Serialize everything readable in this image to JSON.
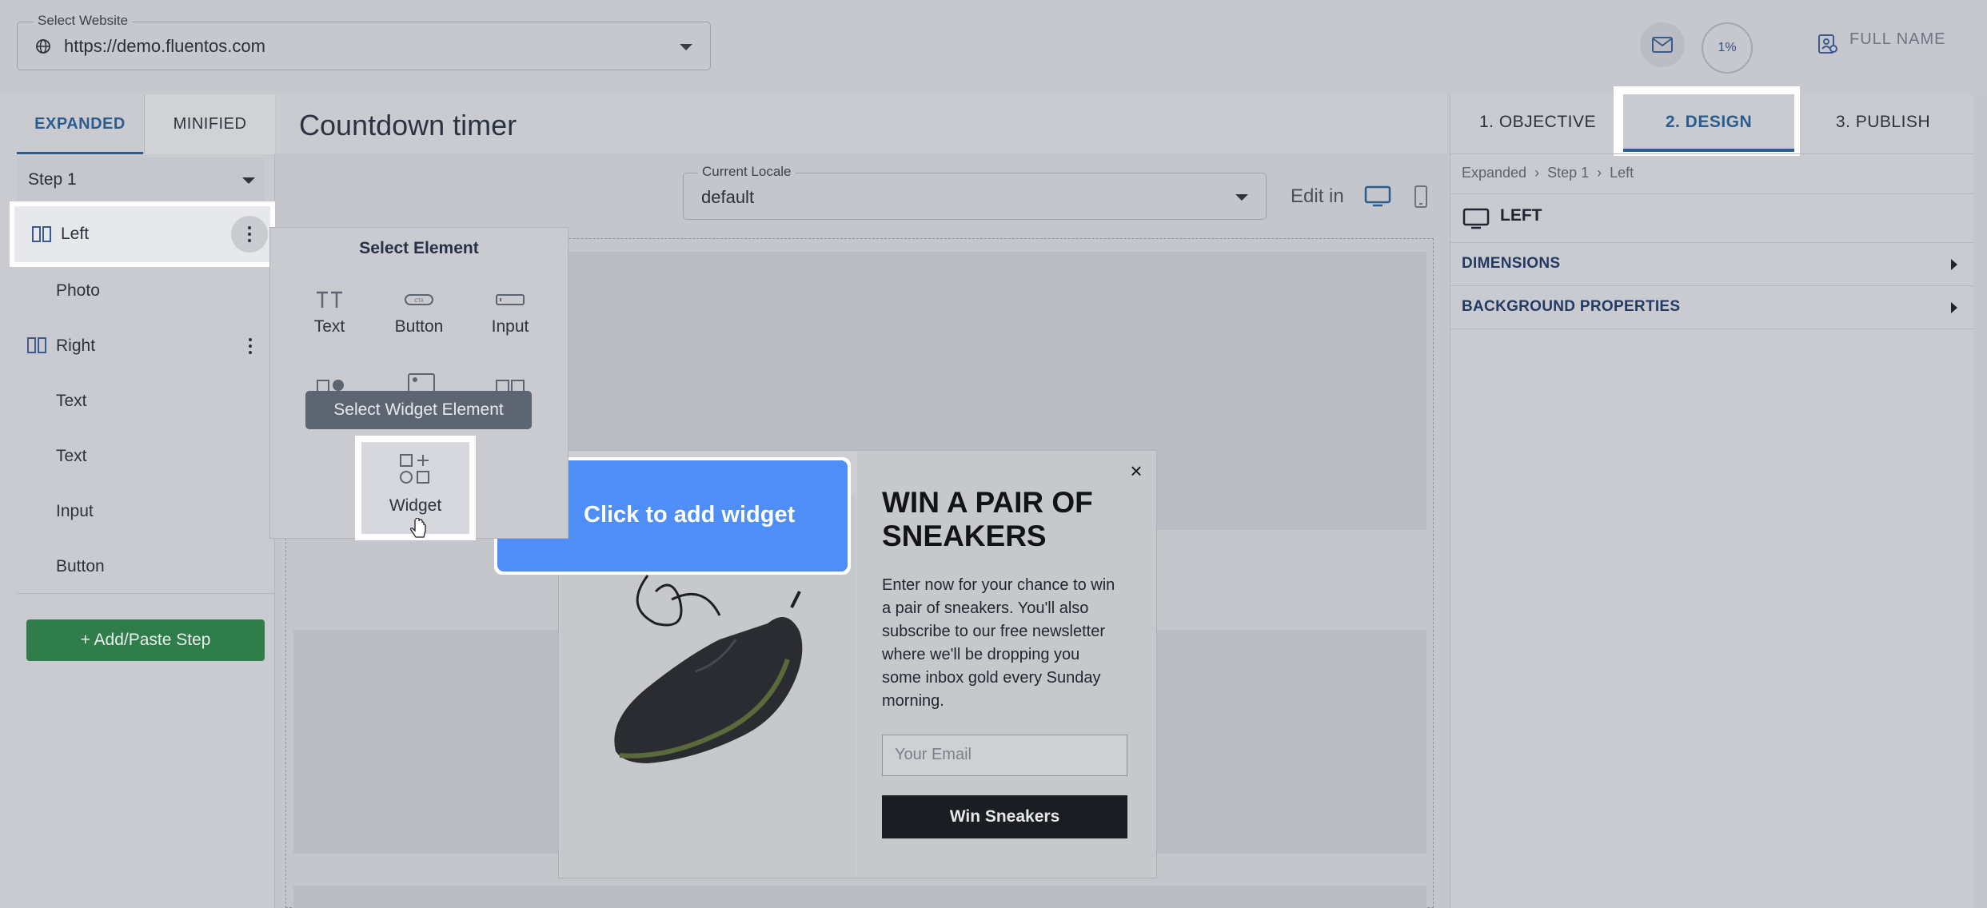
{
  "header": {
    "website_label": "Select Website",
    "website_value": "https://demo.fluentos.com",
    "progress": "1%",
    "user_name": "FULL NAME"
  },
  "left_panel": {
    "tabs": [
      {
        "label": "EXPANDED"
      },
      {
        "label": "MINIFIED"
      }
    ],
    "step_select": "Step 1",
    "tree": [
      {
        "label": "Left"
      },
      {
        "label": "Photo"
      },
      {
        "label": "Right"
      },
      {
        "label": "Text"
      },
      {
        "label": "Text"
      },
      {
        "label": "Input"
      },
      {
        "label": "Button"
      }
    ],
    "add_step": "+ Add/Paste Step"
  },
  "center": {
    "title": "Countdown timer",
    "locale_label": "Current Locale",
    "locale_value": "default",
    "edit_in": "Edit in"
  },
  "select_element": {
    "title": "Select Element",
    "items": [
      {
        "label": "Text"
      },
      {
        "label": "Button"
      },
      {
        "label": "Input"
      }
    ],
    "tooltip": "Select Widget Element",
    "widget_label": "Widget"
  },
  "popup": {
    "widget_arrow": "<",
    "widget_text": "Click to add widget",
    "title": "WIN A PAIR OF SNEAKERS",
    "description": "Enter now for your chance to win a pair of sneakers. You'll also subscribe to our free newsletter where we'll be dropping you some inbox gold every Sunday morning.",
    "email_placeholder": "Your Email",
    "button": "Win Sneakers",
    "close": "×"
  },
  "right_panel": {
    "tabs": [
      {
        "label": "1. OBJECTIVE"
      },
      {
        "label": "2. DESIGN"
      },
      {
        "label": "3. PUBLISH"
      }
    ],
    "breadcrumb": [
      "Expanded",
      "Step 1",
      "Left"
    ],
    "element_title": "LEFT",
    "sections": [
      {
        "label": "DIMENSIONS"
      },
      {
        "label": "BACKGROUND PROPERTIES"
      }
    ]
  },
  "colors": {
    "accent": "#2b5d8e",
    "widget_blue": "#4f8ef7",
    "add_step_green": "#2e7d4a"
  }
}
